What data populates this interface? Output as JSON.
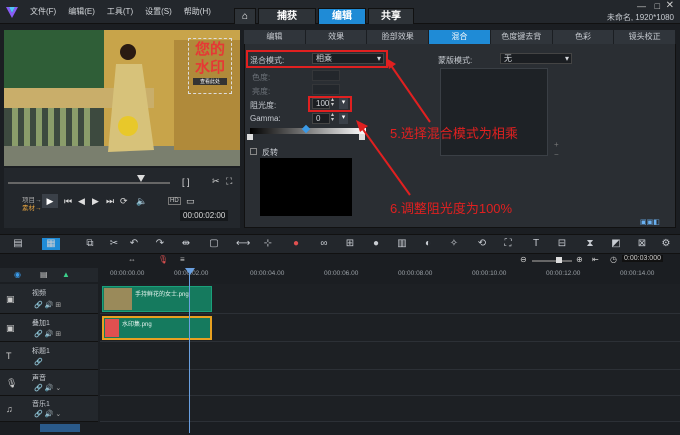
{
  "app": {
    "project_info": "未命名, 1920*1080"
  },
  "menu": [
    "文件(F)",
    "编辑(E)",
    "工具(T)",
    "设置(S)",
    "帮助(H)"
  ],
  "modes": [
    "捕获",
    "编辑",
    "共享"
  ],
  "player": {
    "project_label": "项目→",
    "clip_label": "素材→",
    "hd_label": "HD",
    "timecode": "00:00:02:00"
  },
  "panel": {
    "tabs": [
      "编辑",
      "效果",
      "脸部效果",
      "混合",
      "色度键去背",
      "色彩",
      "镜头校正"
    ],
    "blend_mode_label": "混合模式:",
    "blend_mode_value": "相乘",
    "hue_label": "色度:",
    "saturation_label": "亮度:",
    "opacity_label": "阻光度:",
    "opacity_value": "100",
    "gamma_label": "Gamma:",
    "gamma_value": "0",
    "invert_label": "反转",
    "mask_mode_label": "蒙版模式:",
    "mask_mode_value": "无"
  },
  "annotations": [
    "5.选择混合模式为相乘",
    "6.调整阻光度为100%"
  ],
  "watermark": {
    "text": "您的水印",
    "subtext": "查看此处"
  },
  "timeline": {
    "zoom_timecode": "0:00:03:000",
    "ruler": [
      "00:00:00.00",
      "00:00:02.00",
      "00:00:04.00",
      "00:00:06.00",
      "00:00:08.00",
      "00:00:10.00",
      "00:00:12.00",
      "00:00:14.00"
    ],
    "tracks": [
      {
        "name": "视频",
        "clip": "手持鲜花的女士.png"
      },
      {
        "name": "叠加1",
        "clip": "水印集.png"
      },
      {
        "name": "标题1",
        "clip": ""
      },
      {
        "name": "声音",
        "clip": ""
      },
      {
        "name": "音乐1",
        "clip": ""
      }
    ]
  },
  "colors": {
    "accent": "#1f8bd6",
    "annotation": "#e02020",
    "clip": "#157a5e"
  }
}
